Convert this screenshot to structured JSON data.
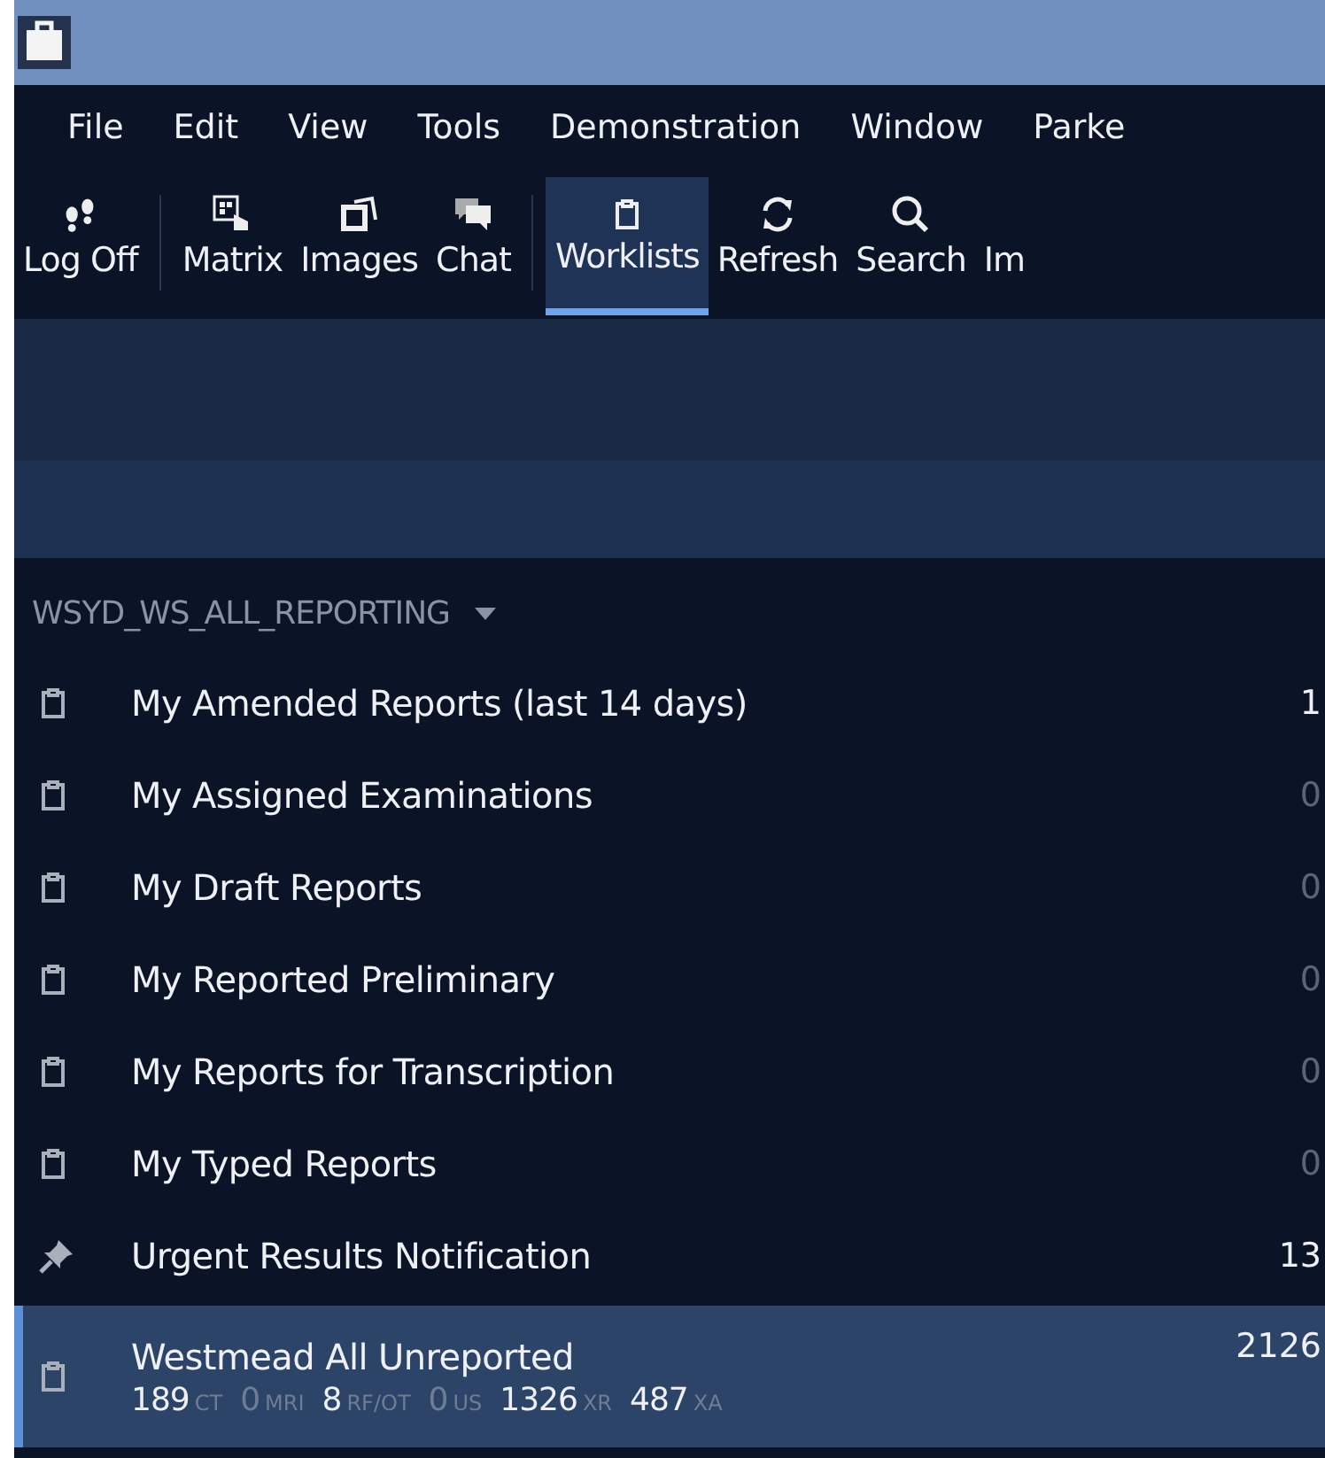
{
  "menu": [
    "File",
    "Edit",
    "View",
    "Tools",
    "Demonstration",
    "Window",
    "Parke"
  ],
  "toolbar": [
    {
      "label": "Log Off",
      "kind": "footprints",
      "selected": false,
      "separator_after": true
    },
    {
      "label": "Matrix",
      "kind": "matrix",
      "selected": false,
      "separator_after": false
    },
    {
      "label": "Images",
      "kind": "images",
      "selected": false,
      "separator_after": false
    },
    {
      "label": "Chat",
      "kind": "chat",
      "selected": false,
      "separator_after": true
    },
    {
      "label": "Worklists",
      "kind": "clipboard",
      "selected": true,
      "separator_after": false
    },
    {
      "label": "Refresh",
      "kind": "refresh",
      "selected": false,
      "separator_after": false
    },
    {
      "label": "Search",
      "kind": "search",
      "selected": false,
      "separator_after": false
    },
    {
      "label": "Im",
      "kind": "cut",
      "selected": false,
      "separator_after": false
    }
  ],
  "group": {
    "title": "WSYD_WS_ALL_REPORTING"
  },
  "worklists": [
    {
      "name": "My Amended Reports (last 14 days)",
      "kind": "clipboard",
      "count": "1",
      "dim": false,
      "selected": false
    },
    {
      "name": "My Assigned Examinations",
      "kind": "clipboard",
      "count": "0",
      "dim": true,
      "selected": false
    },
    {
      "name": "My Draft Reports",
      "kind": "clipboard",
      "count": "0",
      "dim": true,
      "selected": false
    },
    {
      "name": "My Reported Preliminary",
      "kind": "clipboard",
      "count": "0",
      "dim": true,
      "selected": false
    },
    {
      "name": "My Reports for Transcription",
      "kind": "clipboard",
      "count": "0",
      "dim": true,
      "selected": false
    },
    {
      "name": "My Typed Reports",
      "kind": "clipboard",
      "count": "0",
      "dim": true,
      "selected": false
    },
    {
      "name": "Urgent Results Notification",
      "kind": "pin",
      "count": "13",
      "dim": false,
      "selected": false
    },
    {
      "name": "Westmead All Unreported",
      "kind": "clipboard",
      "count": "2126",
      "dim": false,
      "selected": true,
      "breakdown": [
        {
          "count": "189",
          "modality": "CT",
          "dim": false
        },
        {
          "count": "0",
          "modality": "MRI",
          "dim": true
        },
        {
          "count": "8",
          "modality": "RF/OT",
          "dim": false
        },
        {
          "count": "0",
          "modality": "US",
          "dim": true
        },
        {
          "count": "1326",
          "modality": "XR",
          "dim": false
        },
        {
          "count": "487",
          "modality": "XA",
          "dim": false
        }
      ]
    }
  ]
}
